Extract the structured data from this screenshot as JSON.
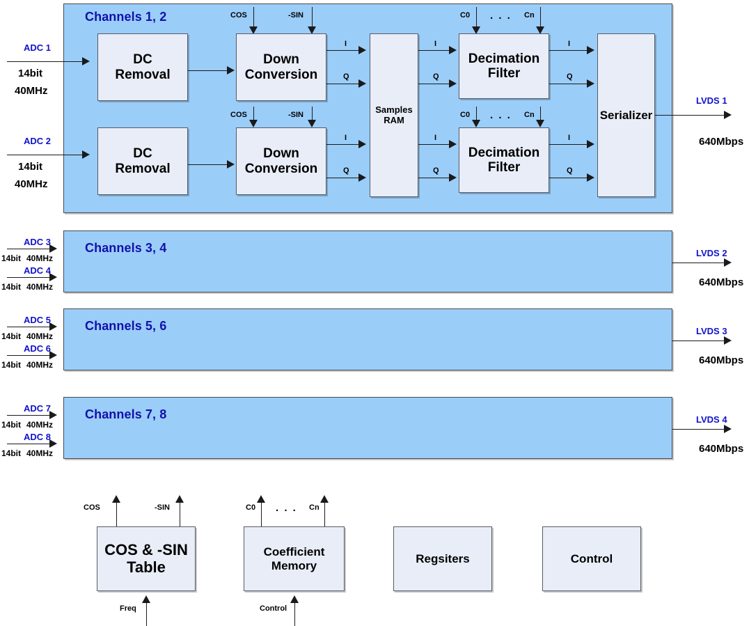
{
  "diagram": {
    "title_implicit": "Multi-channel DDC FPGA block diagram",
    "colors": {
      "group_fill": "#9BCDF9",
      "block_fill": "#E8EDF7",
      "group_title_text": "#1111AA",
      "port_label_text": "#1111CC",
      "line": "#1a1a1a"
    }
  },
  "groups": [
    {
      "id": "ch12",
      "title": "Channels 1, 2",
      "inputs": [
        {
          "name": "ADC 1",
          "width": "14bit",
          "rate": "40MHz"
        },
        {
          "name": "ADC 2",
          "width": "14bit",
          "rate": "40MHz"
        }
      ],
      "output": {
        "name": "LVDS 1",
        "rate": "640Mbps"
      }
    },
    {
      "id": "ch34",
      "title": "Channels 3, 4",
      "inputs": [
        {
          "name": "ADC 3",
          "width": "14bit",
          "rate": "40MHz"
        },
        {
          "name": "ADC 4",
          "width": "14bit",
          "rate": "40MHz"
        }
      ],
      "output": {
        "name": "LVDS 2",
        "rate": "640Mbps"
      }
    },
    {
      "id": "ch56",
      "title": "Channels 5, 6",
      "inputs": [
        {
          "name": "ADC 5",
          "width": "14bit",
          "rate": "40MHz"
        },
        {
          "name": "ADC 6",
          "width": "14bit",
          "rate": "40MHz"
        }
      ],
      "output": {
        "name": "LVDS 3",
        "rate": "640Mbps"
      }
    },
    {
      "id": "ch78",
      "title": "Channels 7, 8",
      "inputs": [
        {
          "name": "ADC 7",
          "width": "14bit",
          "rate": "40MHz"
        },
        {
          "name": "ADC 8",
          "width": "14bit",
          "rate": "40MHz"
        }
      ],
      "output": {
        "name": "LVDS 4",
        "rate": "640Mbps"
      }
    }
  ],
  "chain": {
    "dc_removal": "DC\nRemoval",
    "dc_removal_line1": "DC",
    "dc_removal_line2": "Removal",
    "down_conversion_line1": "Down",
    "down_conversion_line2": "Conversion",
    "samples_ram_line1": "Samples",
    "samples_ram_line2": "RAM",
    "decimation_filter_line1": "Decimation",
    "decimation_filter_line2": "Filter",
    "serializer": "Serializer"
  },
  "signals": {
    "cos": "COS",
    "nsin": "-SIN",
    "c0": "C0",
    "cn": "Cn",
    "dots": ". . .",
    "i": "I",
    "q": "Q",
    "freq": "Freq",
    "control": "Control"
  },
  "bottom_blocks": [
    {
      "id": "cos-sin-table",
      "line1": "COS & -SIN",
      "line2": "Table"
    },
    {
      "id": "coefficient-memory",
      "line1": "Coefficient",
      "line2": "Memory"
    },
    {
      "id": "registers",
      "line1": "Regsiters",
      "line2": ""
    },
    {
      "id": "control",
      "line1": "Control",
      "line2": ""
    }
  ]
}
